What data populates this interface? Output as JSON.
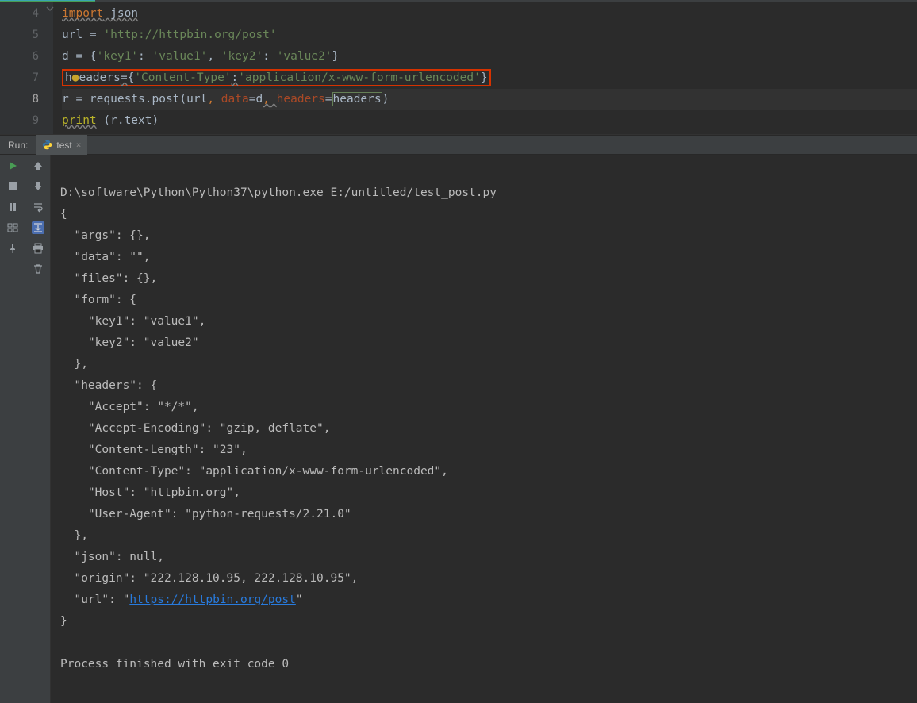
{
  "editor": {
    "line_numbers": [
      "4",
      "5",
      "6",
      "7",
      "8",
      "9"
    ],
    "current_line_index": 4,
    "lines": {
      "l4_import": "import",
      "l4_json": " json",
      "l5_pre": "url = ",
      "l5_str": "'http://httpbin.org/post'",
      "l6_pre": "d = {",
      "l6_k1": "'key1'",
      "l6_c1": ": ",
      "l6_v1": "'value1'",
      "l6_c2": ", ",
      "l6_k2": "'key2'",
      "l6_c3": ": ",
      "l6_v2": "'value2'",
      "l6_end": "}",
      "l7_h": "h",
      "l7_eaders": "eaders",
      "l7_eq": "=",
      "l7_open": "{",
      "l7_k": "'Content-Type'",
      "l7_colon": ":",
      "l7_v": "'application/x-www-form-urlencoded'",
      "l7_close": "}",
      "l8_pre": "r = requests.post(url",
      "l8_c1": ", ",
      "l8_data": "data",
      "l8_eq1": "=d",
      "l8_uc": ",",
      "l8_sp": " ",
      "l8_headers": "headers",
      "l8_eq2": "=",
      "l8_hv": "headers",
      "l8_close": ")",
      "l9_print": "print",
      "l9_rest": " (r.text)"
    }
  },
  "run": {
    "label": "Run:",
    "tab_name": "test",
    "console_lines": [
      "D:\\software\\Python\\Python37\\python.exe E:/untitled/test_post.py",
      "{",
      "  \"args\": {}, ",
      "  \"data\": \"\", ",
      "  \"files\": {}, ",
      "  \"form\": {",
      "    \"key1\": \"value1\", ",
      "    \"key2\": \"value2\"",
      "  }, ",
      "  \"headers\": {",
      "    \"Accept\": \"*/*\", ",
      "    \"Accept-Encoding\": \"gzip, deflate\", ",
      "    \"Content-Length\": \"23\", ",
      "    \"Content-Type\": \"application/x-www-form-urlencoded\", ",
      "    \"Host\": \"httpbin.org\", ",
      "    \"User-Agent\": \"python-requests/2.21.0\"",
      "  }, ",
      "  \"json\": null, ",
      "  \"origin\": \"222.128.10.95, 222.128.10.95\", ",
      "  \"url\": \""
    ],
    "url_link": "https://httpbin.org/post",
    "url_suffix": "\"",
    "closing_brace": "}",
    "blank": "",
    "exit_line": "Process finished with exit code 0"
  }
}
